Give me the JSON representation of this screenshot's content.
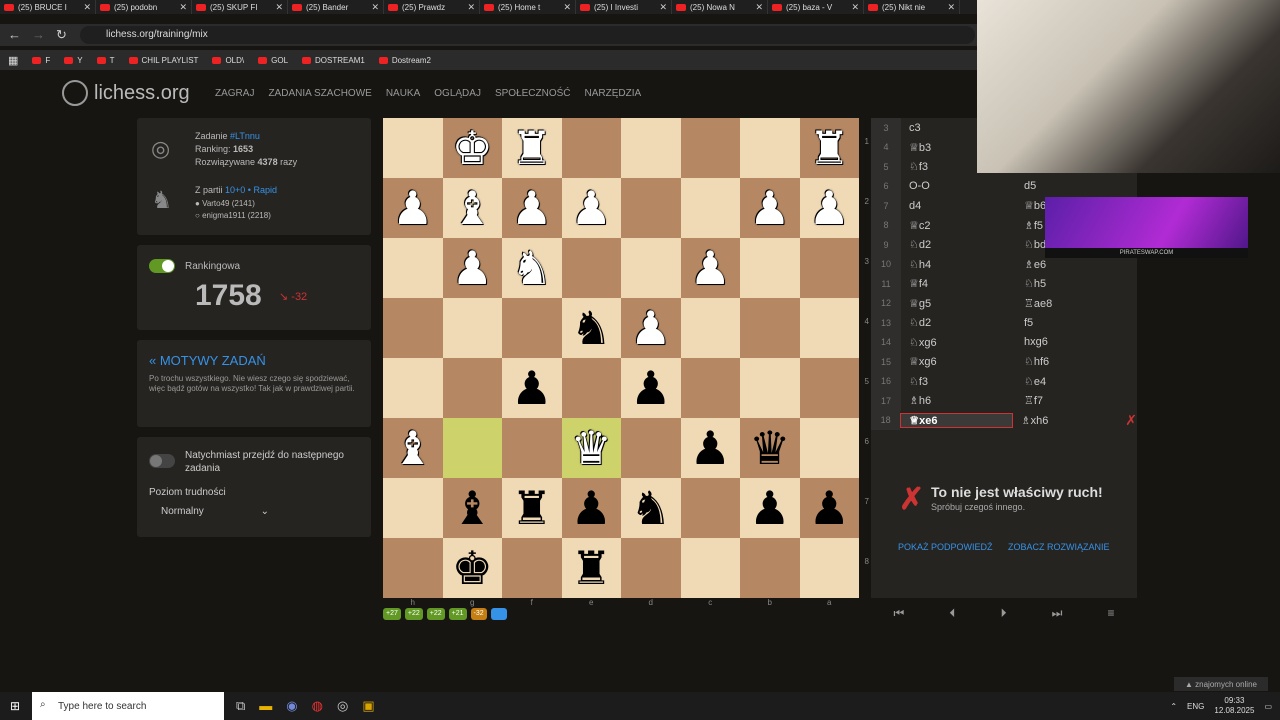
{
  "browser": {
    "tabs": [
      "(25) BRUCE I",
      "(25) podobn",
      "(25) SKUP FI",
      "(25) Bander",
      "(25) Prawdz",
      "(25) Home t",
      "(25) I Investi",
      "(25) Nowa N",
      "(25) baza - V",
      "(25) Nikt nie"
    ],
    "url": "lichess.org/training/mix",
    "bookmarks": [
      "F",
      "Y",
      "T",
      "CHIL PLAYLIST",
      "OLD\\",
      "GOL",
      "DOSTREAM1",
      "Dostream2"
    ]
  },
  "site": {
    "logo": "lichess.org",
    "nav": [
      "ZAGRAJ",
      "ZADANIA SZACHOWE",
      "NAUKA",
      "OGLĄDAJ",
      "SPOŁECZNOŚĆ",
      "NARZĘDZIA"
    ]
  },
  "puzzle": {
    "label": "Zadanie",
    "id": "#LTnnu",
    "ranking_label": "Ranking:",
    "ranking": "1653",
    "played_prefix": "Rozwiązywane",
    "played_count": "4378",
    "played_suffix": "razy",
    "game_prefix": "Z partii",
    "game_link": "10+0 • Rapid",
    "player1": "Varto49 (2141)",
    "player2": "enigma1911 (2218)"
  },
  "rating": {
    "mode": "Rankingowa",
    "value": "1758",
    "delta": "-32"
  },
  "themes": {
    "title": "« MOTYWY ZADAŃ",
    "desc": "Po trochu wszystkiego. Nie wiesz czego się spodziewać, więc bądź gotów na wszystko! Tak jak w prawdziwej partii."
  },
  "settings": {
    "auto_next": "Natychmiast przejdź do następnego zadania",
    "difficulty_label": "Poziom trudności",
    "difficulty_value": "Normalny"
  },
  "board": {
    "ranks": [
      "1",
      "2",
      "3",
      "4",
      "5",
      "6",
      "7",
      "8"
    ],
    "files": [
      "h",
      "g",
      "f",
      "e",
      "d",
      "c",
      "b",
      "a"
    ],
    "rows": [
      [
        "",
        "♚w",
        "♜w",
        "",
        "",
        "",
        "",
        "♜w"
      ],
      [
        "♟w",
        "♝w",
        "♟w",
        "♟w",
        "",
        "",
        "♟w",
        "♟w"
      ],
      [
        "",
        "♟w",
        "♞w",
        "",
        "",
        "♟w",
        "",
        ""
      ],
      [
        "",
        "",
        "",
        "♞b",
        "♟w",
        "",
        "",
        ""
      ],
      [
        "",
        "",
        "♟b",
        "",
        "♟b",
        "",
        "",
        ""
      ],
      [
        "♝w",
        "",
        "",
        "♛w",
        "",
        "♟b",
        "♛b",
        ""
      ],
      [
        "",
        "♝b",
        "♜b",
        "♟b",
        "♞b",
        "",
        "♟b",
        "♟b"
      ],
      [
        "",
        "♚b",
        "",
        "♜b",
        "",
        "",
        "",
        ""
      ]
    ],
    "highlight": [
      "5-1",
      "5-3"
    ]
  },
  "history": [
    "+27",
    "+22",
    "+22",
    "+21",
    "-32"
  ],
  "moves": [
    {
      "n": "3",
      "w": "c3",
      "b": ""
    },
    {
      "n": "4",
      "w": "♕b3",
      "b": ""
    },
    {
      "n": "5",
      "w": "♘f3",
      "b": ""
    },
    {
      "n": "6",
      "w": "O-O",
      "b": "d5"
    },
    {
      "n": "7",
      "w": "d4",
      "b": "♕b6"
    },
    {
      "n": "8",
      "w": "♕c2",
      "b": "♗f5"
    },
    {
      "n": "9",
      "w": "♘d2",
      "b": "♘bd7"
    },
    {
      "n": "10",
      "w": "♘h4",
      "b": "♗e6"
    },
    {
      "n": "11",
      "w": "♕f4",
      "b": "♘h5"
    },
    {
      "n": "12",
      "w": "♕g5",
      "b": "♖ae8"
    },
    {
      "n": "13",
      "w": "♘d2",
      "b": "f5"
    },
    {
      "n": "14",
      "w": "♘xg6",
      "b": "hxg6"
    },
    {
      "n": "15",
      "w": "♕xg6",
      "b": "♘hf6"
    },
    {
      "n": "16",
      "w": "♘f3",
      "b": "♘e4"
    },
    {
      "n": "17",
      "w": "♗h6",
      "b": "♖f7"
    },
    {
      "n": "18",
      "w": "♕xe6",
      "b": "♗xh6"
    }
  ],
  "feedback": {
    "title": "To nie jest właściwy ruch!",
    "subtitle": "Spróbuj czegoś innego.",
    "hint": "POKAŻ PODPOWIEDŹ",
    "solution": "ZOBACZ ROZWIĄZANIE"
  },
  "ad": {
    "text": "PIRATESWAP.COM"
  },
  "status": {
    "online": "▲ znajomych online"
  },
  "taskbar": {
    "search": "Type here to search",
    "lang": "ENG",
    "time": "09:33",
    "date": "12.08.2025"
  }
}
